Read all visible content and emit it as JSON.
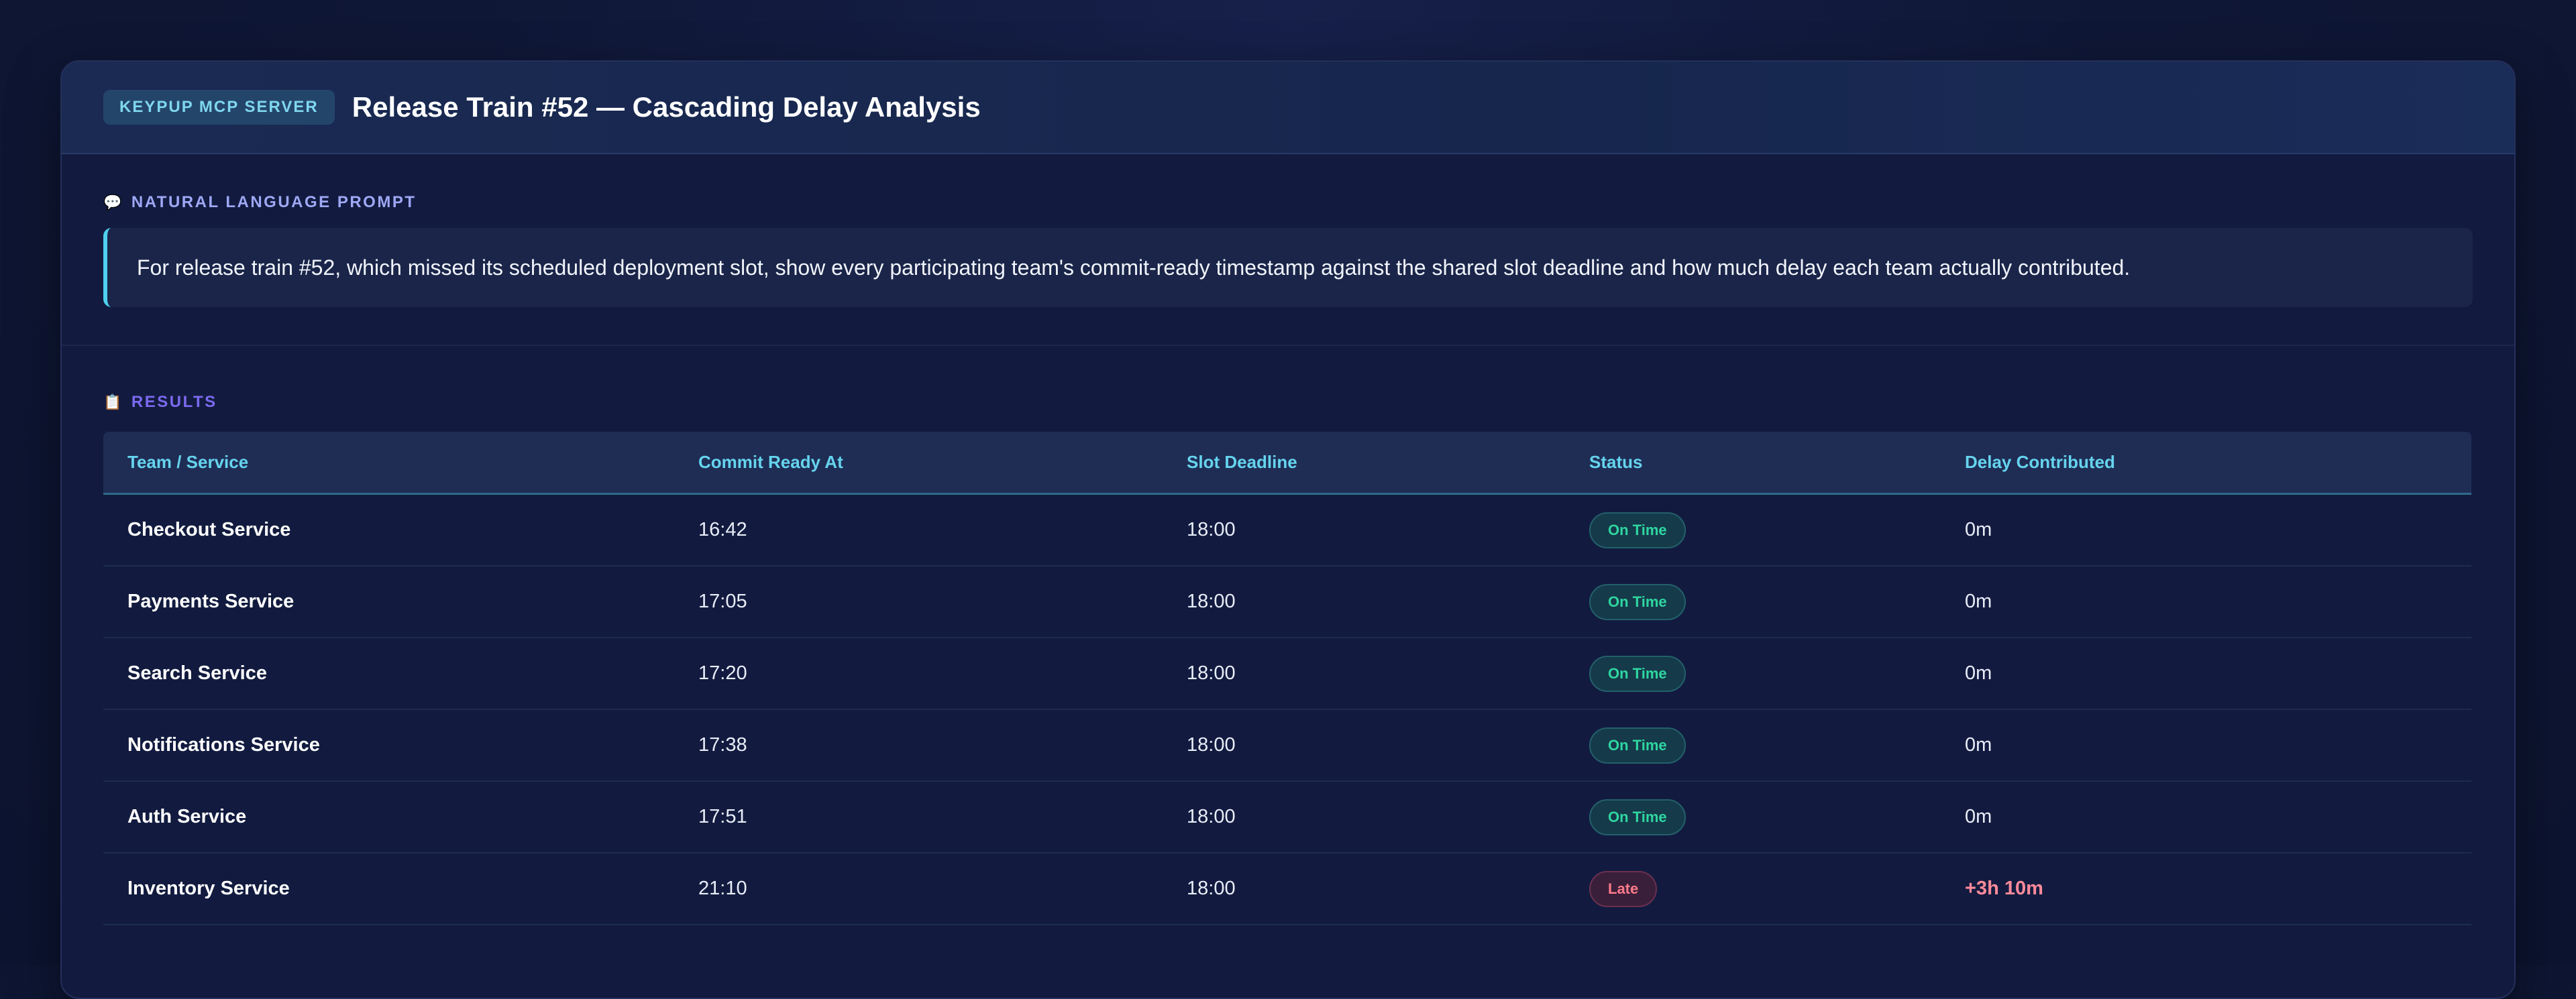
{
  "header": {
    "badge": "KEYPUP MCP SERVER",
    "title": "Release Train #52 — Cascading Delay Analysis"
  },
  "prompt": {
    "icon": "speech-bubble-icon",
    "label": "NATURAL LANGUAGE PROMPT",
    "text": "For release train #52, which missed its scheduled deployment slot, show every participating team's commit-ready timestamp against the shared slot deadline and how much delay each team actually contributed."
  },
  "results": {
    "icon": "clipboard-icon",
    "label": "RESULTS",
    "columns": [
      "Team / Service",
      "Commit Ready At",
      "Slot Deadline",
      "Status",
      "Delay Contributed"
    ],
    "rows": [
      {
        "team": "Checkout Service",
        "ready": "16:42",
        "deadline": "18:00",
        "status": "On Time",
        "delay": "0m"
      },
      {
        "team": "Payments Service",
        "ready": "17:05",
        "deadline": "18:00",
        "status": "On Time",
        "delay": "0m"
      },
      {
        "team": "Search Service",
        "ready": "17:20",
        "deadline": "18:00",
        "status": "On Time",
        "delay": "0m"
      },
      {
        "team": "Notifications Service",
        "ready": "17:38",
        "deadline": "18:00",
        "status": "On Time",
        "delay": "0m"
      },
      {
        "team": "Auth Service",
        "ready": "17:51",
        "deadline": "18:00",
        "status": "On Time",
        "delay": "0m"
      },
      {
        "team": "Inventory Service",
        "ready": "21:10",
        "deadline": "18:00",
        "status": "Late",
        "delay": "+3h 10m"
      }
    ]
  },
  "colors": {
    "accent": "#4fd0ee",
    "on_time": "#2fd6a0",
    "late": "#ff7a8a"
  }
}
